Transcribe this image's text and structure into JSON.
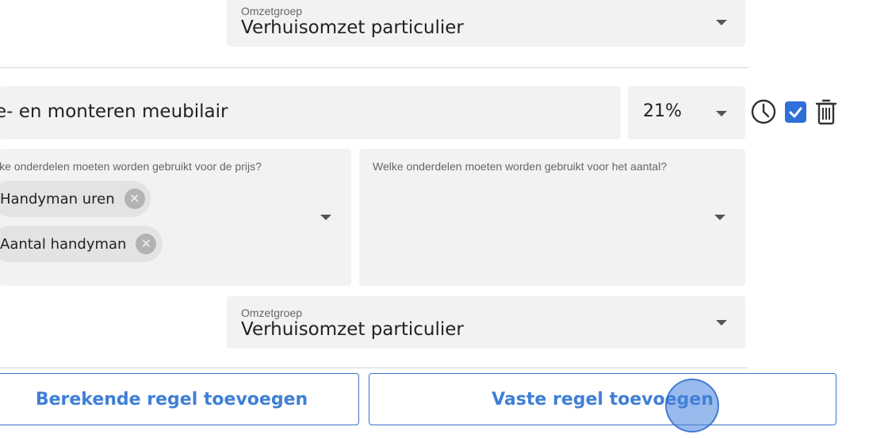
{
  "top_revenue_group": {
    "label": "Omzetgroep",
    "value": "Verhuisomzet particulier"
  },
  "line_item": {
    "description": "e- en monteren meubilair",
    "vat": "21%",
    "checkbox_checked": true
  },
  "price_parts": {
    "label": "lke onderdelen moeten worden gebruikt voor de prijs?",
    "chips": [
      "Handyman uren",
      "Aantal handyman"
    ]
  },
  "quantity_parts": {
    "label": "Welke onderdelen moeten worden gebruikt voor het aantal?"
  },
  "bottom_revenue_group": {
    "label": "Omzetgroep",
    "value": "Verhuisomzet particulier"
  },
  "buttons": {
    "calculated": "Berekende regel toevoegen",
    "fixed": "Vaste regel toevoegen"
  },
  "colors": {
    "accent": "#3f7fd6",
    "checkbox": "#2f6fd8",
    "field_bg": "#f2f2f2"
  }
}
